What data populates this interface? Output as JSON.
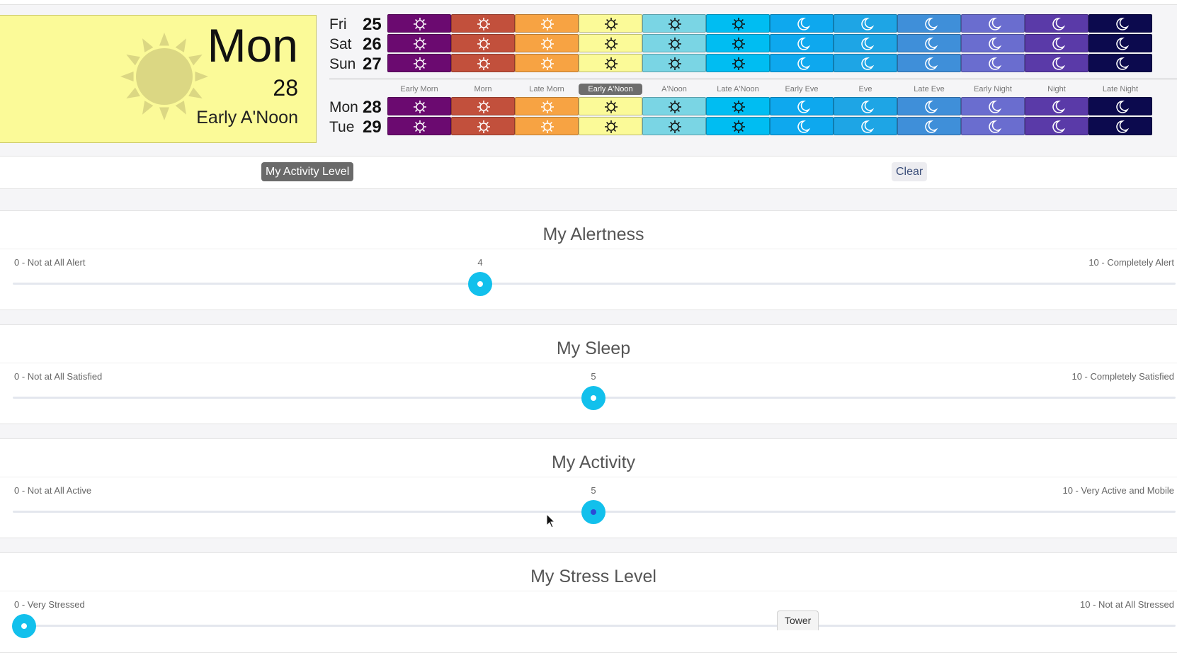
{
  "selected_day": {
    "weekday": "Mon",
    "date": "28",
    "period": "Early A'Noon"
  },
  "periods": [
    "Early Morn",
    "Morn",
    "Late Morn",
    "Early A'Noon",
    "A'Noon",
    "Late A'Noon",
    "Early Eve",
    "Eve",
    "Late Eve",
    "Early Night",
    "Night",
    "Late Night"
  ],
  "period_colors": [
    "#6b0a70",
    "#c2503c",
    "#f7a343",
    "#fbfa98",
    "#7ad5e4",
    "#00bdf2",
    "#0ea8ee",
    "#1ea5e5",
    "#3f8fd9",
    "#6a6dcf",
    "#5a3aa8",
    "#0c0a4e"
  ],
  "period_icons": [
    "sunrise-icon",
    "sun-icon",
    "sun-icon",
    "sun-icon",
    "sun-icon",
    "sunset-icon",
    "moon-icon",
    "moon-icon",
    "moon-icon",
    "moon-icon",
    "moon-icon",
    "moon-icon"
  ],
  "selected_period_index": 3,
  "days_before": [
    {
      "weekday": "Fri",
      "date": "25"
    },
    {
      "weekday": "Sat",
      "date": "26"
    },
    {
      "weekday": "Sun",
      "date": "27"
    }
  ],
  "days_after": [
    {
      "weekday": "Mon",
      "date": "28"
    },
    {
      "weekday": "Tue",
      "date": "29"
    }
  ],
  "toolbar": {
    "activity_label": "My Activity Level",
    "clear_label": "Clear"
  },
  "sliders": [
    {
      "title": "My Alertness",
      "min_label": "0 - Not at All Alert",
      "max_label": "10 - Completely Alert",
      "value": "4"
    },
    {
      "title": "My Sleep",
      "min_label": "0 - Not at All Satisfied",
      "max_label": "10 - Completely Satisfied",
      "value": "5"
    },
    {
      "title": "My Activity",
      "min_label": "0 - Not at All Active",
      "max_label": "10 - Very Active and Mobile",
      "value": "5"
    },
    {
      "title": "My Stress Level",
      "min_label": "0 - Very Stressed",
      "max_label": "10 - Not at All Stressed",
      "value": "0"
    }
  ],
  "tooltip": "Tower"
}
